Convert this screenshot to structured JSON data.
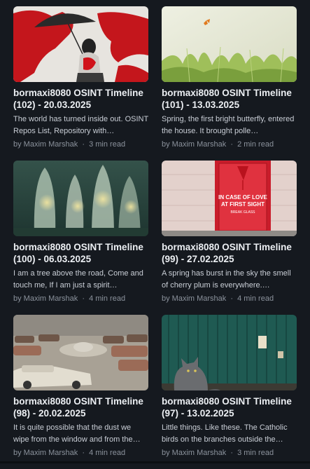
{
  "posts": [
    {
      "title": "bormaxi8080 OSINT Timeline (102) - 20.03.2025",
      "excerpt": "The world has turned inside out. OSINT Repos List, Repository with…",
      "author": "by Maxim Marshak",
      "separator": "·",
      "read_time": "3 min read",
      "image_icon": "girl-umbrella-world-map-image"
    },
    {
      "title": "bormaxi8080 OSINT Timeline (101) - 13.03.2025",
      "excerpt": "Spring, the first bright butterfly, entered the house. It brought polle…",
      "author": "by Maxim Marshak",
      "separator": "·",
      "read_time": "2 min read",
      "image_icon": "butterfly-grass-image"
    },
    {
      "title": "bormaxi8080 OSINT Timeline (100) - 06.03.2025",
      "excerpt": "I am a tree above the road, Come and touch me, If I am just a spirit…",
      "author": "by Maxim Marshak",
      "separator": "·",
      "read_time": "4 min read",
      "image_icon": "glowing-ghosts-forest-image"
    },
    {
      "title": "bormaxi8080 OSINT Timeline (99) - 27.02.2025",
      "excerpt": "A spring has burst in the sky the smell of cherry plum is everywhere.…",
      "author": "by Maxim Marshak",
      "separator": "·",
      "read_time": "4 min read",
      "image_icon": "in-case-of-love-box-image",
      "image_text_1": "IN CASE OF LOVE",
      "image_text_2": "AT FIRST SIGHT",
      "image_text_3": "BREAK GLASS"
    },
    {
      "title": "bormaxi8080 OSINT Timeline (98) - 20.02.2025",
      "excerpt": "It is quite possible that the dust we wipe from the window and from the…",
      "author": "by Maxim Marshak",
      "separator": "·",
      "read_time": "4 min read",
      "image_icon": "ufo-car-junkyard-image"
    },
    {
      "title": "bormaxi8080 OSINT Timeline (97) - 13.02.2025",
      "excerpt": "Little things. Like these. The Catholic birds on the branches outside the…",
      "author": "by Maxim Marshak",
      "separator": "·",
      "read_time": "3 min read",
      "image_icon": "cat-green-wall-image"
    }
  ],
  "colors": {
    "background": "#15191f",
    "title": "#eceff3",
    "excerpt": "#c9ced6",
    "meta": "#8b929c"
  }
}
